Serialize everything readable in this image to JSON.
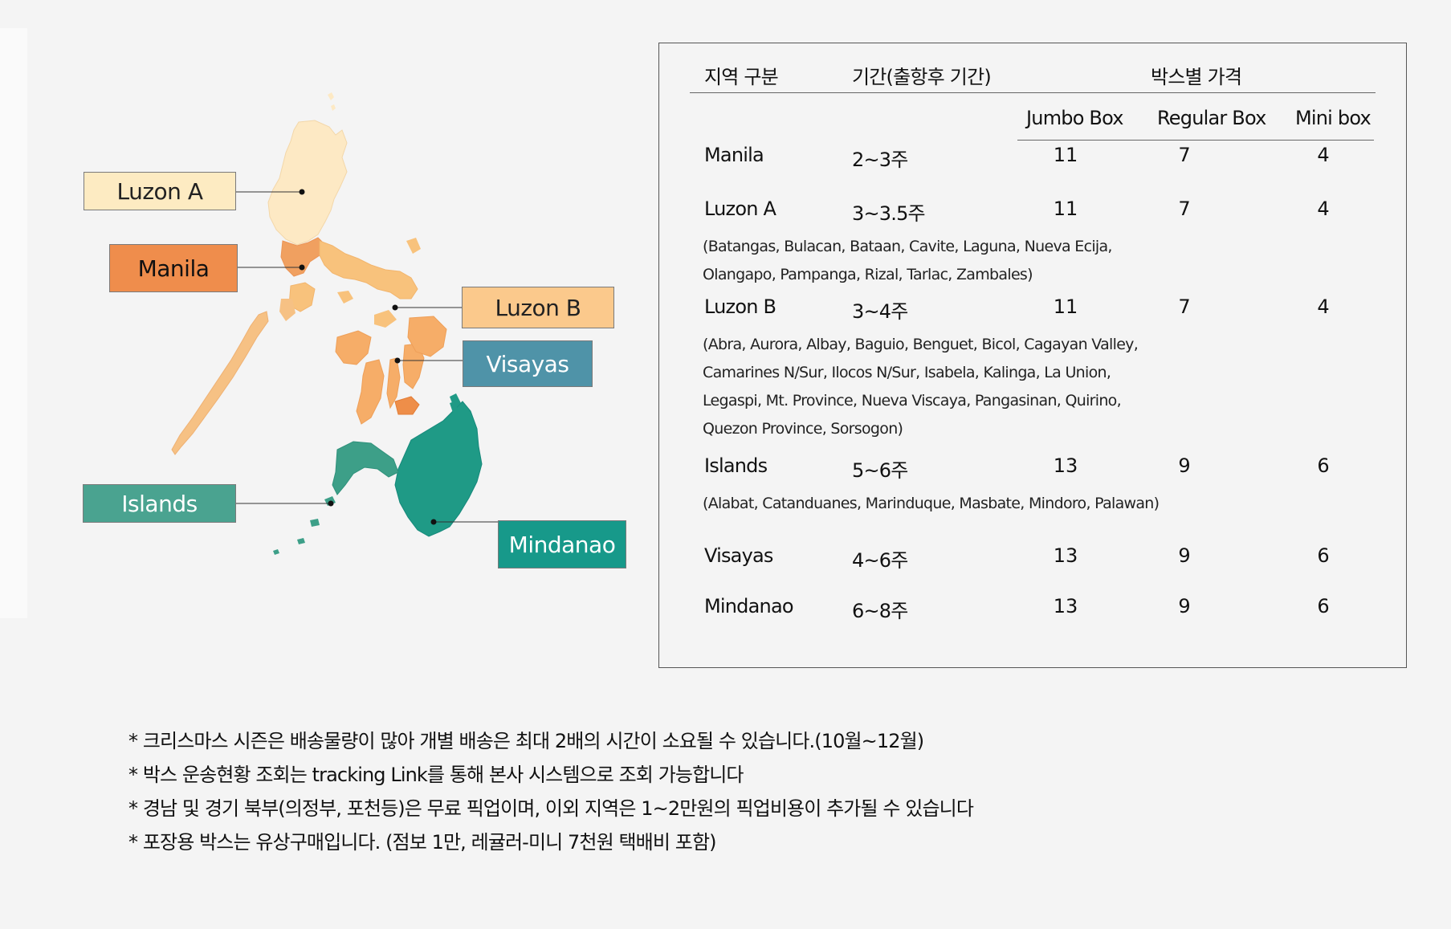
{
  "map": {
    "labels": {
      "luzon_a": "Luzon A",
      "manila": "Manila",
      "luzon_b": "Luzon B",
      "visayas": "Visayas",
      "islands": "Islands",
      "mindanao": "Mindanao"
    },
    "colors": {
      "luzon_a": "#fdebc2",
      "manila": "#ef8d4c",
      "luzon_b": "#fbc98c",
      "visayas": "#4f93a8",
      "islands": "#4aa390",
      "mindanao": "#17998a"
    }
  },
  "table": {
    "headers": {
      "region": "지역 구분",
      "period": "기간(출항후 기간)",
      "price": "박스별 가격",
      "jumbo": "Jumbo Box",
      "regular": "Regular Box",
      "mini": "Mini box"
    },
    "rows": [
      {
        "region": "Manila",
        "period": "2~3주",
        "jumbo": "11",
        "regular": "7",
        "mini": "4",
        "areas": []
      },
      {
        "region": "Luzon A",
        "period": "3~3.5주",
        "jumbo": "11",
        "regular": "7",
        "mini": "4",
        "areas": [
          "(Batangas, Bulacan, Bataan, Cavite, Laguna, Nueva Ecija,",
          "Olangapo, Pampanga, Rizal, Tarlac, Zambales)"
        ]
      },
      {
        "region": "Luzon B",
        "period": "3~4주",
        "jumbo": "11",
        "regular": "7",
        "mini": "4",
        "areas": [
          "(Abra, Aurora, Albay, Baguio, Benguet, Bicol, Cagayan Valley,",
          "Camarines N/Sur, Ilocos N/Sur, Isabela, Kalinga, La Union,",
          "Legaspi, Mt. Province, Nueva Viscaya, Pangasinan, Quirino,",
          "Quezon Province, Sorsogon)"
        ]
      },
      {
        "region": "Islands",
        "period": "5~6주",
        "jumbo": "13",
        "regular": "9",
        "mini": "6",
        "areas": [
          "(Alabat, Catanduanes, Marinduque, Masbate, Mindoro, Palawan)"
        ]
      },
      {
        "region": "Visayas",
        "period": "4~6주",
        "jumbo": "13",
        "regular": "9",
        "mini": "6",
        "areas": []
      },
      {
        "region": "Mindanao",
        "period": "6~8주",
        "jumbo": "13",
        "regular": "9",
        "mini": "6",
        "areas": []
      }
    ]
  },
  "notes": [
    "* 크리스마스 시즌은 배송물량이 많아 개별 배송은 최대 2배의 시간이 소요될 수 있습니다.(10월~12월)",
    "* 박스 운송현황 조회는 tracking Link를 통해 본사 시스템으로 조회 가능합니다",
    "* 경남 및 경기 북부(의정부, 포천등)은 무료 픽업이며, 이외 지역은 1~2만원의 픽업비용이 추가될 수 있습니다",
    "* 포장용 박스는 유상구매입니다. (점보 1만, 레귤러-미니 7천원 택배비 포함)"
  ]
}
